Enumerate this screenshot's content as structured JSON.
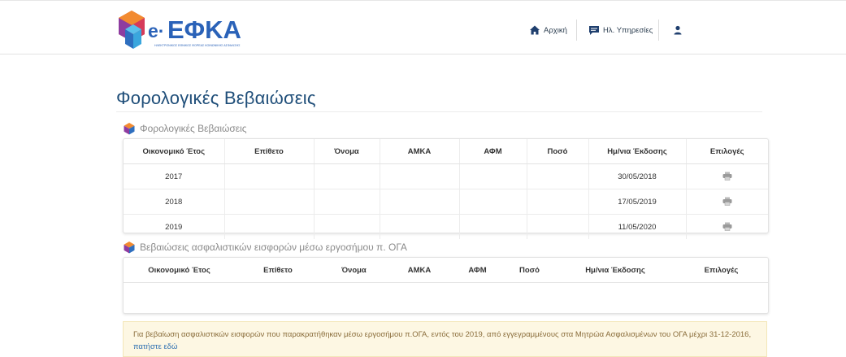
{
  "brand": {
    "name": "e-ΕΦΚΑ",
    "prefix": "e·",
    "wordmark": "ΕΦΚΑ",
    "tagline": "ΗΛΕΚΤΡΟΝΙΚΟΣ ΕΘΝΙΚΟΣ ΦΟΡΕΑΣ ΚΟΙΝΩΝΙΚΗΣ ΑΣΦΑΛΙΣΗΣ",
    "color": "#2a62b8"
  },
  "nav": {
    "home": {
      "label": "Αρχική",
      "icon": "home-icon"
    },
    "services": {
      "label": "Ηλ. Υπηρεσίες",
      "icon": "chat-icon"
    },
    "user": {
      "icon": "user-icon"
    }
  },
  "page": {
    "title": "Φορολογικές Βεβαιώσεις"
  },
  "section1": {
    "title": "Φορολογικές Βεβαιώσεις",
    "columns": [
      "Οικονομικό Έτος",
      "Επίθετο",
      "Όνομα",
      "ΑΜΚΑ",
      "ΑΦΜ",
      "Ποσό",
      "Ημ/νια Έκδοσης",
      "Επιλογές"
    ],
    "rows": [
      {
        "year": "2017",
        "surname": "",
        "name": "",
        "amka": "",
        "afm": "",
        "amount": "",
        "date": "30/05/2018",
        "action_icon": "printer-icon"
      },
      {
        "year": "2018",
        "surname": "",
        "name": "",
        "amka": "",
        "afm": "",
        "amount": "",
        "date": "17/05/2019",
        "action_icon": "printer-icon"
      },
      {
        "year": "2019",
        "surname": "",
        "name": "",
        "amka": "",
        "afm": "",
        "amount": "",
        "date": "11/05/2020",
        "action_icon": "printer-icon"
      }
    ]
  },
  "section2": {
    "title": "Βεβαιώσεις ασφαλιστικών εισφορών μέσω εργοσήμου π. ΟΓΑ",
    "columns": [
      "Οικονομικό Έτος",
      "Επίθετο",
      "Όνομα",
      "ΑΜΚΑ",
      "ΑΦΜ",
      "Ποσό",
      "Ημ/νια Έκδοσης",
      "Επιλογές"
    ]
  },
  "notice": {
    "text": "Για βεβαίωση ασφαλιστικών εισφορών που παρακρατήθηκαν μέσω εργοσήμου π.ΟΓΑ, εντός του 2019, από εγγεγραμμένους στα Μητρώα Ασφαλισμένων του ΟΓΑ μέχρι 31-12-2016,",
    "link": "πατήστε εδώ"
  },
  "colors": {
    "title": "#1f4e79",
    "notice_bg": "#fdf7e3",
    "notice_text": "#8a6d3b",
    "link": "#2a6db0"
  }
}
